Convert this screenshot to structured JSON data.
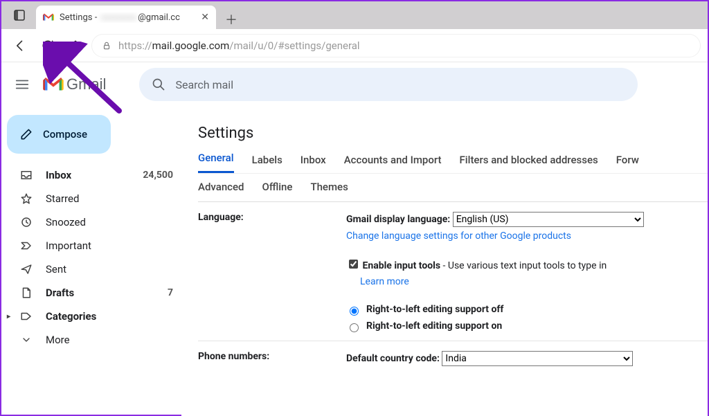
{
  "browser": {
    "tab_icon": "gmail",
    "tab_title_prefix": "Settings - ",
    "tab_title_suffix": "@gmail.cc",
    "url_scheme": "https://",
    "url_host": "mail.google.com",
    "url_path": "/mail/u/0/#settings/general"
  },
  "gmail": {
    "product_name": "Gmail",
    "search_placeholder": "Search mail",
    "compose_label": "Compose"
  },
  "sidebar": {
    "items": [
      {
        "label": "Inbox",
        "count": "24,500",
        "bold": true
      },
      {
        "label": "Starred"
      },
      {
        "label": "Snoozed"
      },
      {
        "label": "Important"
      },
      {
        "label": "Sent"
      },
      {
        "label": "Drafts",
        "count": "7",
        "bold": true
      },
      {
        "label": "Categories",
        "bold": true
      },
      {
        "label": "More"
      }
    ]
  },
  "settings": {
    "title": "Settings",
    "primary_tabs": [
      "General",
      "Labels",
      "Inbox",
      "Accounts and Import",
      "Filters and blocked addresses",
      "Forw"
    ],
    "secondary_tabs": [
      "Advanced",
      "Offline",
      "Themes"
    ],
    "active_primary": "General",
    "language": {
      "label": "Language:",
      "display_label": "Gmail display language:",
      "selected": "English (US)",
      "change_link": "Change language settings for other Google products",
      "enable_input_tools_label": "Enable input tools",
      "enable_input_tools_desc": " - Use various text input tools to type in",
      "learn_more": "Learn more",
      "rtl_off": "Right-to-left editing support off",
      "rtl_on": "Right-to-left editing support on",
      "rtl_selected": "off"
    },
    "phone": {
      "label": "Phone numbers:",
      "default_cc_label": "Default country code:",
      "selected": "India"
    }
  },
  "colors": {
    "accent": "#0b57d0",
    "link": "#1a73e8",
    "search_bg": "#eaf1fb",
    "compose_bg": "#c2e7ff",
    "annotation": "#6a0dad"
  }
}
